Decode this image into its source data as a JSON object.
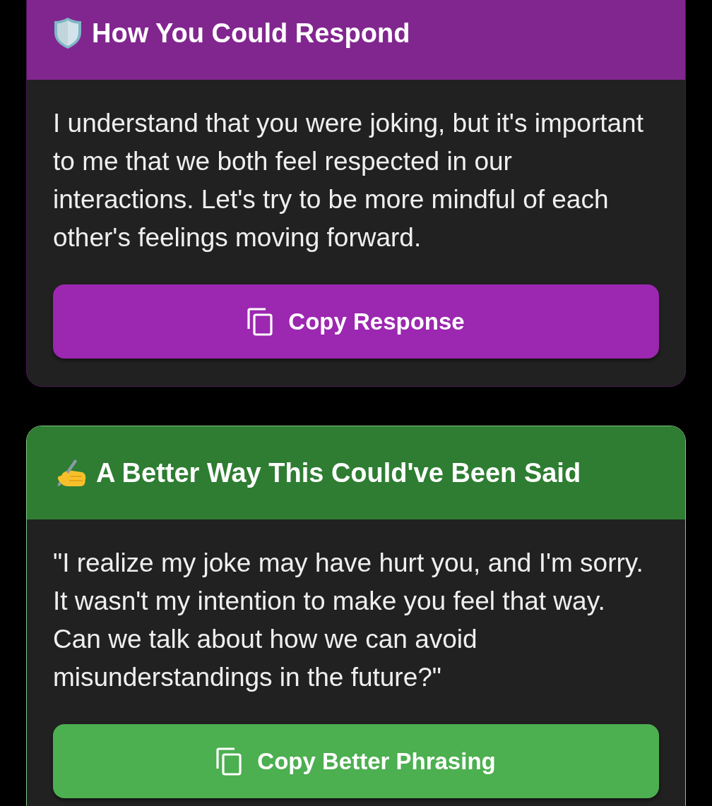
{
  "cards": [
    {
      "kind": "respond",
      "title": "How You Could Respond",
      "text": "I understand that you were joking, but it's important to me that we both feel respected in our interactions. Let's try to be more mindful of each other's feelings moving forward.",
      "button": "Copy Response"
    },
    {
      "kind": "rephrase",
      "title": "A Better Way This Could've Been Said",
      "text": "\"I realize my joke may have hurt you, and I'm sorry. It wasn't my intention to make you feel that way. Can we talk about how we can avoid misunderstandings in the future?\"",
      "button": "Copy Better Phrasing"
    }
  ]
}
